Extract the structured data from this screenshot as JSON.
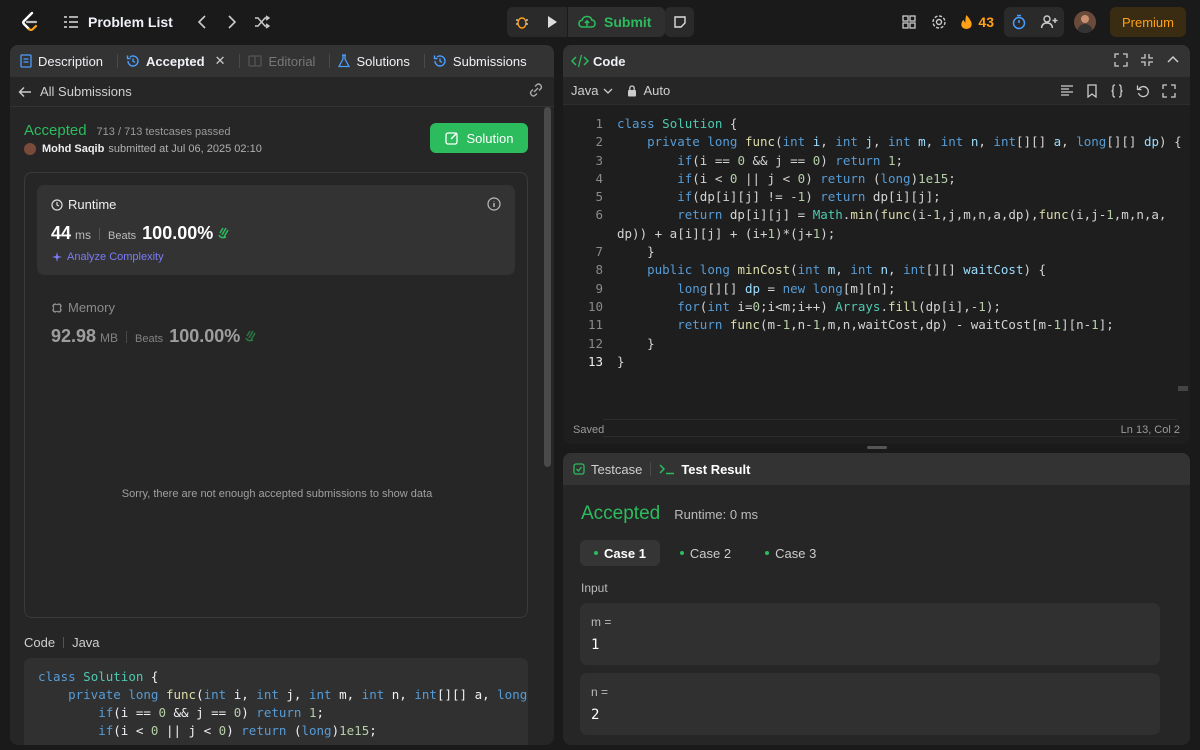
{
  "nav": {
    "title": "Problem List",
    "submit_label": "Submit",
    "streak_count": "43",
    "premium_label": "Premium"
  },
  "left_tabs": [
    {
      "label": "Description"
    },
    {
      "label": "Accepted"
    },
    {
      "label": "Editorial"
    },
    {
      "label": "Solutions"
    },
    {
      "label": "Submissions"
    }
  ],
  "submission": {
    "back_label": "All Submissions",
    "status": "Accepted",
    "testcases": "713 / 713 testcases passed",
    "author": "Mohd Saqib",
    "submitted_at": "submitted at Jul 06, 2025 02:10",
    "solution_button": "Solution",
    "runtime": {
      "label": "Runtime",
      "value": "44",
      "unit": "ms",
      "beats_label": "Beats",
      "beats": "100.00%",
      "analyze_label": "Analyze Complexity"
    },
    "memory": {
      "label": "Memory",
      "value": "92.98",
      "unit": "MB",
      "beats_label": "Beats",
      "beats": "100.00%"
    },
    "no_data_message": "Sorry, there are not enough accepted submissions to show data",
    "code_label": "Code",
    "code_lang": "Java",
    "code_preview": [
      "class Solution {",
      "    private long func(int i, int j, int m, int n, int[][] a, long[",
      "        if(i == 0 && j == 0) return 1;",
      "        if(i < 0 || j < 0) return (long)1e15;"
    ]
  },
  "editor": {
    "header_label": "Code",
    "language": "Java",
    "mode": "Auto",
    "status": "Saved",
    "cursor_pos": "Ln 13, Col 2",
    "line_numbers": [
      "1",
      "2",
      "3",
      "4",
      "5",
      "6",
      "",
      "7",
      "8",
      "9",
      "10",
      "11",
      "12",
      "13"
    ]
  },
  "test_result": {
    "tabs": [
      {
        "label": "Testcase"
      },
      {
        "label": "Test Result"
      }
    ],
    "status": "Accepted",
    "runtime": "Runtime: 0 ms",
    "cases": [
      {
        "label": "Case 1"
      },
      {
        "label": "Case 2"
      },
      {
        "label": "Case 3"
      }
    ],
    "input_label": "Input",
    "inputs": [
      {
        "name": "m =",
        "value": "1"
      },
      {
        "name": "n =",
        "value": "2"
      }
    ]
  },
  "colors": {
    "accent_green": "#2cbb5d",
    "accent_orange": "#ffa116",
    "analyze_purple": "#7c7cf8"
  }
}
